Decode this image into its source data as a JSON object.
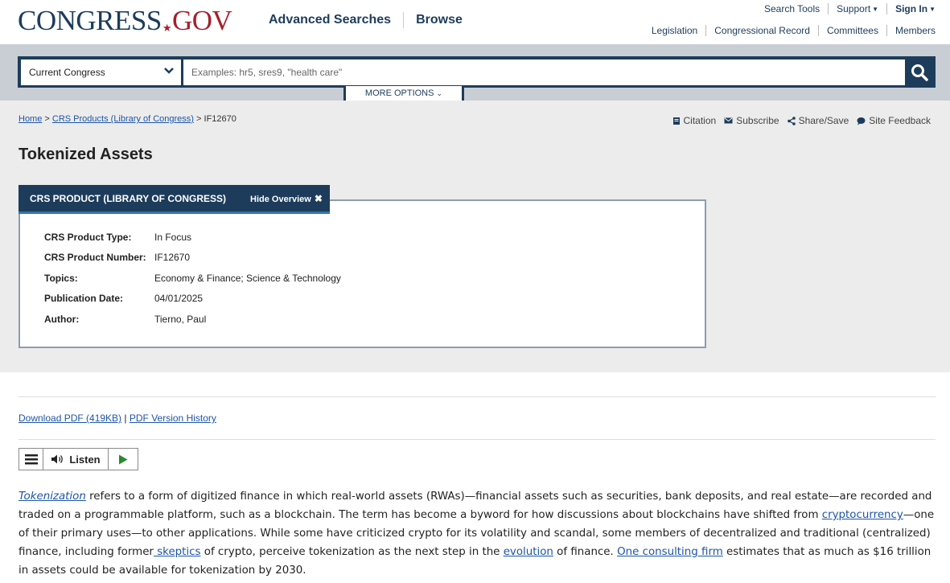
{
  "header": {
    "logo_part1": "CONGRESS",
    "logo_star": "★",
    "logo_part2": "GOV",
    "nav": [
      "Advanced Searches",
      "Browse"
    ],
    "top_links": {
      "search_tools": "Search Tools",
      "support": "Support",
      "sign_in": "Sign In"
    },
    "sub_links": [
      "Legislation",
      "Congressional Record",
      "Committees",
      "Members"
    ]
  },
  "search": {
    "scope": "Current Congress",
    "placeholder": "Examples: hr5, sres9, \"health care\"",
    "more_options": "MORE OPTIONS"
  },
  "breadcrumb": {
    "home": "Home",
    "sep": ">",
    "crs": "CRS Products (Library of Congress)",
    "current": "IF12670"
  },
  "tools": [
    "Citation",
    "Subscribe",
    "Share/Save",
    "Site Feedback"
  ],
  "page_title": "Tokenized Assets",
  "overview": {
    "tab_label": "CRS PRODUCT (LIBRARY OF CONGRESS)",
    "hide_label": "Hide Overview",
    "rows": [
      {
        "label": "CRS Product Type:",
        "value": "In Focus"
      },
      {
        "label": "CRS Product Number:",
        "value": "IF12670"
      },
      {
        "label": "Topics:",
        "value": "Economy & Finance; Science & Technology"
      },
      {
        "label": "Publication Date:",
        "value": "04/01/2025"
      },
      {
        "label": "Author:",
        "value": "Tierno, Paul"
      }
    ]
  },
  "downloads": {
    "pdf": "Download PDF (419KB)",
    "sep": "|",
    "history": "PDF Version History"
  },
  "player": {
    "listen": "Listen"
  },
  "article": {
    "link_tokenization": "Tokenization",
    "t1": " refers to a form of digitized finance in which real-world assets (RWAs)—financial assets such as securities, bank deposits, and real estate—are recorded and traded on a programmable platform, such as a blockchain. The term has become a byword for how discussions about blockchains have shifted from ",
    "link_crypto": "cryptocurrency",
    "t2": "—one of their primary uses—to other applications. While some have criticized crypto for its volatility and scandal, some members of decentralized and traditional (centralized) finance, including former",
    "link_skeptics": " skeptics",
    "t3": " of crypto, perceive tokenization as the next step in the ",
    "link_evolution": "evolution",
    "t4": " of finance. ",
    "link_firm": "One consulting firm",
    "t5": " estimates that as much as $16 trillion in assets could be available for tokenization by 2030."
  },
  "colors": {
    "navy": "#1d3c5b",
    "red": "#a5202d",
    "link": "#1d55a8",
    "accent_blue": "#3476a9"
  }
}
